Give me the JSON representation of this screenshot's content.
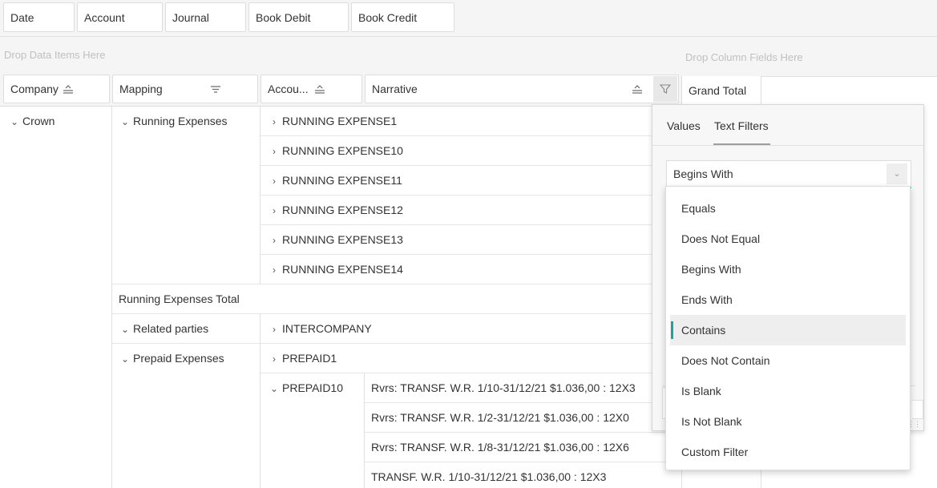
{
  "top_fields": [
    "Date",
    "Account",
    "Journal",
    "Book Debit",
    "Book Credit"
  ],
  "drop_data_hint": "Drop Data Items Here",
  "drop_column_hint": "Drop Column Fields Here",
  "row_headers": {
    "company": "Company",
    "mapping": "Mapping",
    "account": "Accou...",
    "narrative": "Narrative"
  },
  "grand_total_label": "Grand Total",
  "grid": {
    "company": "Crown",
    "mapping_running": "Running Expenses",
    "running_accounts": [
      "RUNNING EXPENSE1",
      "RUNNING EXPENSE10",
      "RUNNING EXPENSE11",
      "RUNNING EXPENSE12",
      "RUNNING EXPENSE13",
      "RUNNING EXPENSE14"
    ],
    "running_total": "Running Expenses Total",
    "mapping_related": "Related parties",
    "related_account": "INTERCOMPANY",
    "mapping_prepaid": "Prepaid Expenses",
    "prepaid_accounts": [
      "PREPAID1",
      "PREPAID10"
    ],
    "narratives": [
      "Rvrs: TRANSF. W.R. 1/10-31/12/21 $1.036,00 : 12X3",
      "Rvrs: TRANSF. W.R. 1/2-31/12/21 $1.036,00 : 12X0",
      "Rvrs: TRANSF. W.R. 1/8-31/12/21 $1.036,00 : 12X6",
      "TRANSF. W.R. 1/10-31/12/21 $1.036,00 : 12X3"
    ]
  },
  "filter_panel": {
    "tabs": [
      "Values",
      "Text Filters"
    ],
    "active_tab": "Text Filters",
    "selected_condition": "Begins With",
    "options": [
      "Equals",
      "Does Not Equal",
      "Begins With",
      "Ends With",
      "Contains",
      "Does Not Contain",
      "Is Blank",
      "Is Not Blank",
      "Custom Filter"
    ],
    "highlighted_option": "Contains"
  },
  "colors": {
    "accent": "#1aa59c",
    "border": "#dddddd",
    "panel_bg": "#f7f7f7"
  },
  "icons": [
    "sort-icon",
    "filter-icon",
    "chevron-down-icon",
    "chevron-right-icon"
  ]
}
